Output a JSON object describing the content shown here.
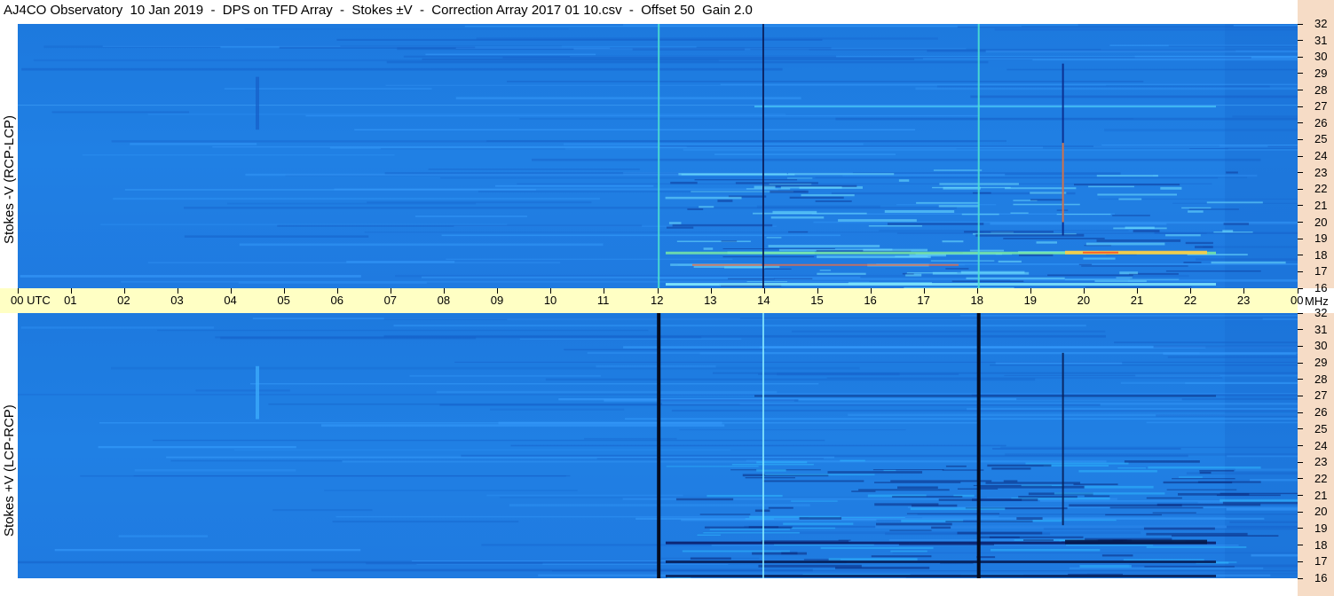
{
  "title": "AJ4CO Observatory  10 Jan 2019  -  DPS on TFD Array  -  Stokes ±V  -  Correction Array 2017 01 10.csv  -  Offset 50  Gain 2.0",
  "panels": [
    {
      "label": "Stokes -V (RCP-LCP)"
    },
    {
      "label": "Stokes +V (LCP-RCP)"
    }
  ],
  "time_axis": {
    "labels": [
      "00 UTC",
      "01",
      "02",
      "03",
      "04",
      "05",
      "06",
      "07",
      "08",
      "09",
      "10",
      "11",
      "12",
      "13",
      "14",
      "15",
      "16",
      "17",
      "18",
      "19",
      "20",
      "21",
      "22",
      "23",
      "00"
    ]
  },
  "freq_axis": {
    "unit": "MHz",
    "labels": [
      "32",
      "31",
      "30",
      "29",
      "28",
      "27",
      "26",
      "25",
      "24",
      "23",
      "22",
      "21",
      "20",
      "19",
      "18",
      "17",
      "16"
    ]
  },
  "colors": {
    "background_blue": "#1f7fe0",
    "time_axis_bg": "#ffffc4",
    "freq_axis_bg": "#f6dcc6"
  },
  "chart_data": {
    "type": "heatmap",
    "title": "AJ4CO Observatory  10 Jan 2019  -  DPS on TFD Array  -  Stokes ±V  -  Correction Array 2017 01 10.csv  -  Offset 50  Gain 2.0",
    "xlabel": "UTC",
    "ylabel": "MHz",
    "xlim": [
      0,
      24
    ],
    "ylim": [
      16,
      32
    ],
    "panels": [
      "Stokes -V (RCP-LCP)",
      "Stokes +V (LCP-RCP)"
    ]
  }
}
